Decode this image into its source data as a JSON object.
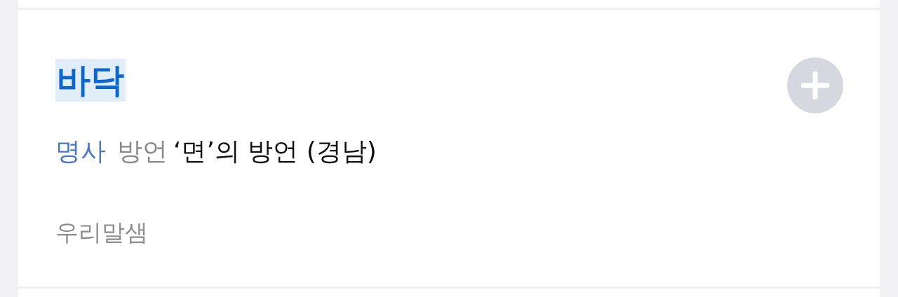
{
  "entry": {
    "headword": "바닥",
    "highlighted": true,
    "part_of_speech": "명사",
    "usage_label": "방언",
    "definition": "‘면’의 방언 (경남)",
    "source": "우리말샘"
  }
}
